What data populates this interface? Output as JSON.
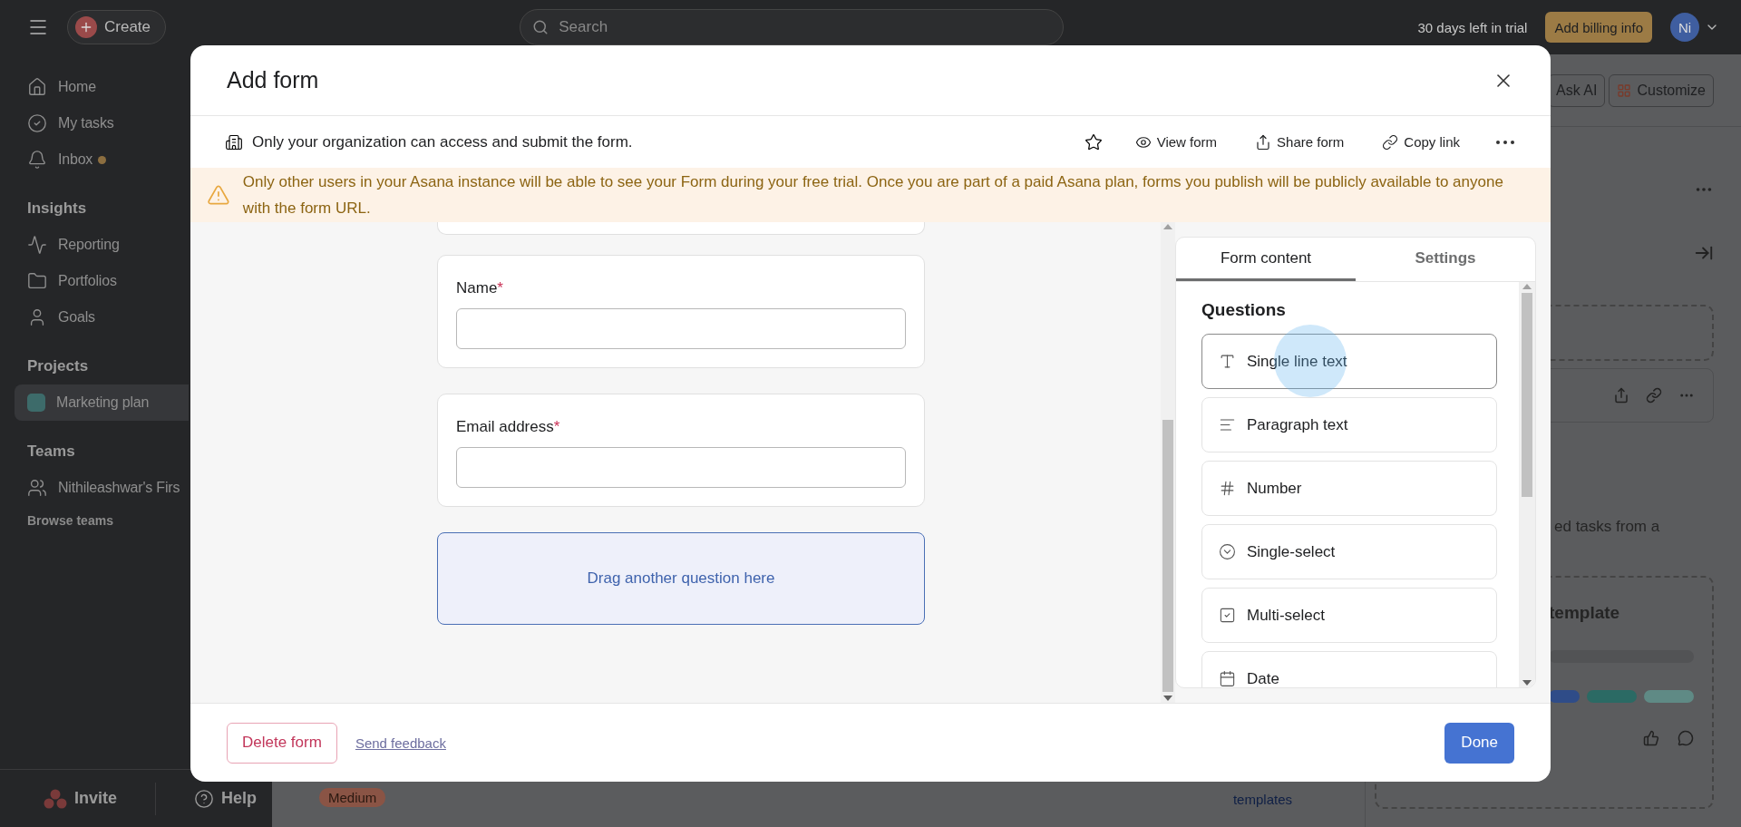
{
  "topbar": {
    "create": "Create",
    "search_placeholder": "Search",
    "trial": "30 days left in trial",
    "billing": "Add billing info",
    "avatar": "Ni"
  },
  "sidebar": {
    "nav": [
      {
        "label": "Home",
        "kind": "home",
        "dot": false
      },
      {
        "label": "My tasks",
        "kind": "tasks",
        "dot": false
      },
      {
        "label": "Inbox",
        "kind": "inbox",
        "dot": true
      }
    ],
    "sections": [
      {
        "title": "Insights",
        "items": [
          {
            "label": "Reporting",
            "kind": "reporting",
            "selected": false
          },
          {
            "label": "Portfolios",
            "kind": "portfolios",
            "selected": false
          },
          {
            "label": "Goals",
            "kind": "goals",
            "selected": false
          }
        ]
      },
      {
        "title": "Projects",
        "items": [
          {
            "label": "Marketing plan",
            "kind": "project",
            "color": "#3d6b6a",
            "selected": true
          }
        ]
      },
      {
        "title": "Teams",
        "items": [
          {
            "label": "Nithileashwar's Firs",
            "kind": "team",
            "selected": false
          }
        ],
        "link": "Browse teams"
      }
    ],
    "invite": "Invite",
    "help": "Help"
  },
  "background": {
    "ask_ai": "Ask AI",
    "customize": "Customize",
    "snippet": "ed tasks from a",
    "template_heading": "template",
    "tag": "Medium",
    "link": "templates"
  },
  "modal": {
    "title": "Add form",
    "access": "Only your organization can access and submit the form.",
    "actions": [
      {
        "label": "View form",
        "kind": "view"
      },
      {
        "label": "Share form",
        "kind": "share"
      },
      {
        "label": "Copy link",
        "kind": "copy"
      }
    ],
    "warning": "Only other users in your Asana instance will be able to see your Form during your free trial. Once you are part of a paid Asana plan, forms you publish will be publicly available to anyone with the form URL.",
    "questions": [
      {
        "label": "Name",
        "required_mark": "*"
      },
      {
        "label": "Email address",
        "required_mark": "*"
      }
    ],
    "drop_zone": "Drag another question here",
    "tabs": [
      {
        "label": "Form content",
        "selected": true
      },
      {
        "label": "Settings",
        "selected": false
      }
    ],
    "panel_heading": "Questions",
    "question_types": [
      {
        "label": "Single line text",
        "kind": "text",
        "highlighted": true
      },
      {
        "label": "Paragraph text",
        "kind": "paragraph",
        "highlighted": false
      },
      {
        "label": "Number",
        "kind": "number",
        "highlighted": false
      },
      {
        "label": "Single-select",
        "kind": "single",
        "highlighted": false
      },
      {
        "label": "Multi-select",
        "kind": "multi",
        "highlighted": false
      },
      {
        "label": "Date",
        "kind": "date",
        "highlighted": false
      }
    ],
    "delete": "Delete form",
    "feedback": "Send feedback",
    "done": "Done"
  }
}
